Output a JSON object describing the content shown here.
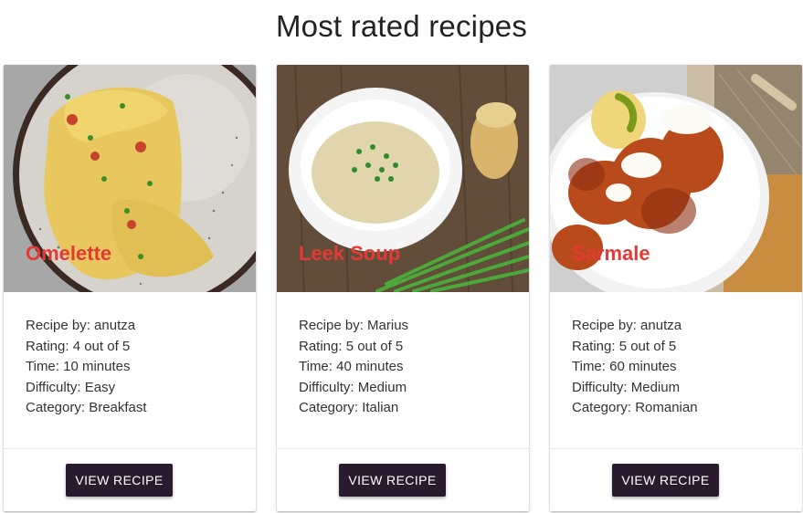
{
  "page": {
    "title": "Most rated recipes"
  },
  "recipes": [
    {
      "name": "Omelette",
      "image": "omelette-photo",
      "author_line": "Recipe by: anutza",
      "rating_line": "Rating: 4 out of 5",
      "time_line": "Time: 10 minutes",
      "difficulty_line": "Difficulty: Easy",
      "category_line": "Category: Breakfast",
      "button_label": "VIEW RECIPE"
    },
    {
      "name": "Leek Soup",
      "image": "leek-soup-photo",
      "author_line": "Recipe by: Marius",
      "rating_line": "Rating: 5 out of 5",
      "time_line": "Time: 40 minutes",
      "difficulty_line": "Difficulty: Medium",
      "category_line": "Category: Italian",
      "button_label": "VIEW RECIPE"
    },
    {
      "name": "Sarmale",
      "image": "sarmale-photo",
      "author_line": "Recipe by: anutza",
      "rating_line": "Rating: 5 out of 5",
      "time_line": "Time: 60 minutes",
      "difficulty_line": "Difficulty: Medium",
      "category_line": "Category: Romanian",
      "button_label": "VIEW RECIPE"
    }
  ],
  "colors": {
    "title_text": "#e53935",
    "button_bg": "#2a1a2e",
    "button_text": "#ffffff"
  }
}
